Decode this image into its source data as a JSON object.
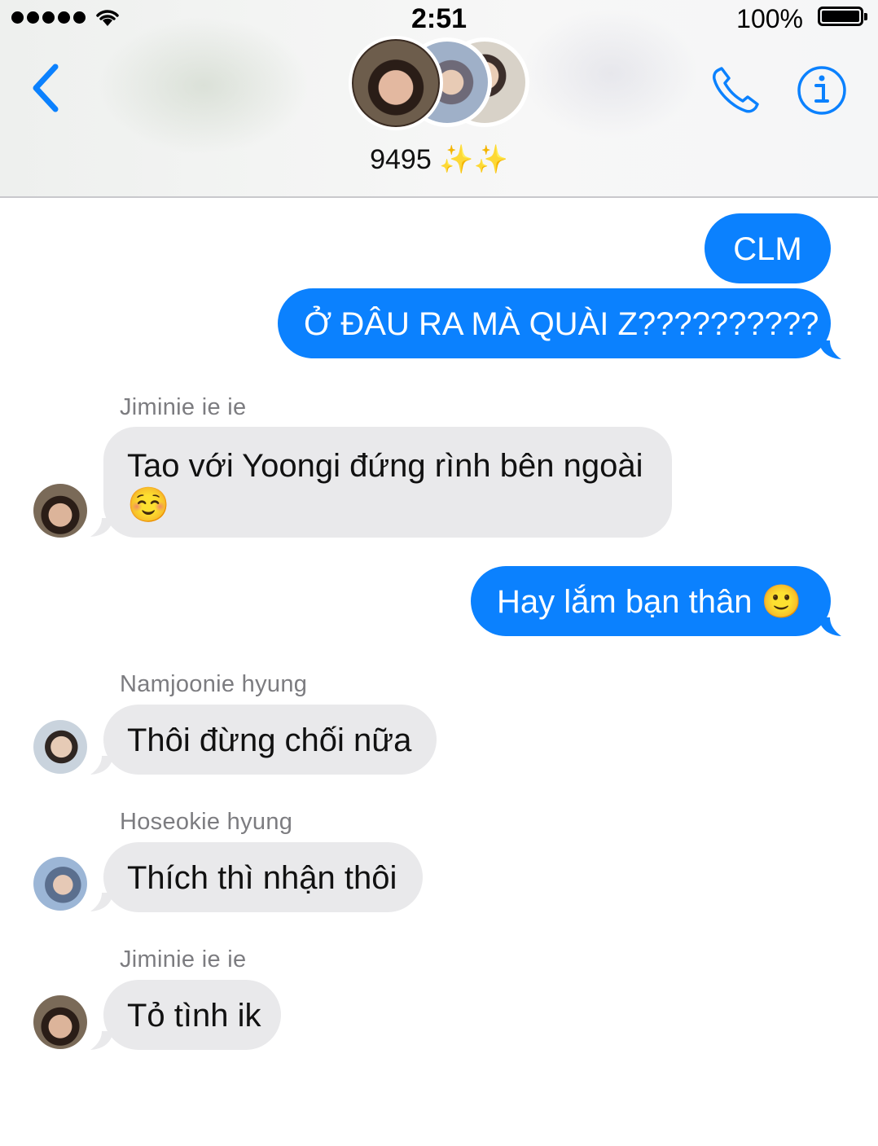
{
  "status_bar": {
    "time": "2:51",
    "battery_percent": "100%",
    "battery_level": 1.0,
    "signal_bars": 5
  },
  "header": {
    "group_name": "9495 ✨✨",
    "back_icon": "chevron-left-icon",
    "call_icon": "phone-icon",
    "info_icon": "info-icon",
    "accent_color": "#0b81fe"
  },
  "messages": [
    {
      "direction": "outgoing",
      "text": "CLM"
    },
    {
      "direction": "outgoing",
      "text": "Ở ĐÂU RA MÀ QUÀI Z??????????"
    },
    {
      "direction": "incoming",
      "sender": "Jiminie ie ie",
      "text_line1": "Tao với Yoongi đứng rình bên ngoài",
      "text_line2": "☺️"
    },
    {
      "direction": "outgoing",
      "text": "Hay lắm bạn thân 🙂"
    },
    {
      "direction": "incoming",
      "sender": "Namjoonie hyung",
      "text": "Thôi đừng chối nữa"
    },
    {
      "direction": "incoming",
      "sender": "Hoseokie hyung",
      "text": "Thích thì nhận thôi"
    },
    {
      "direction": "incoming",
      "sender": "Jiminie ie ie",
      "text": "Tỏ tình ik"
    }
  ]
}
